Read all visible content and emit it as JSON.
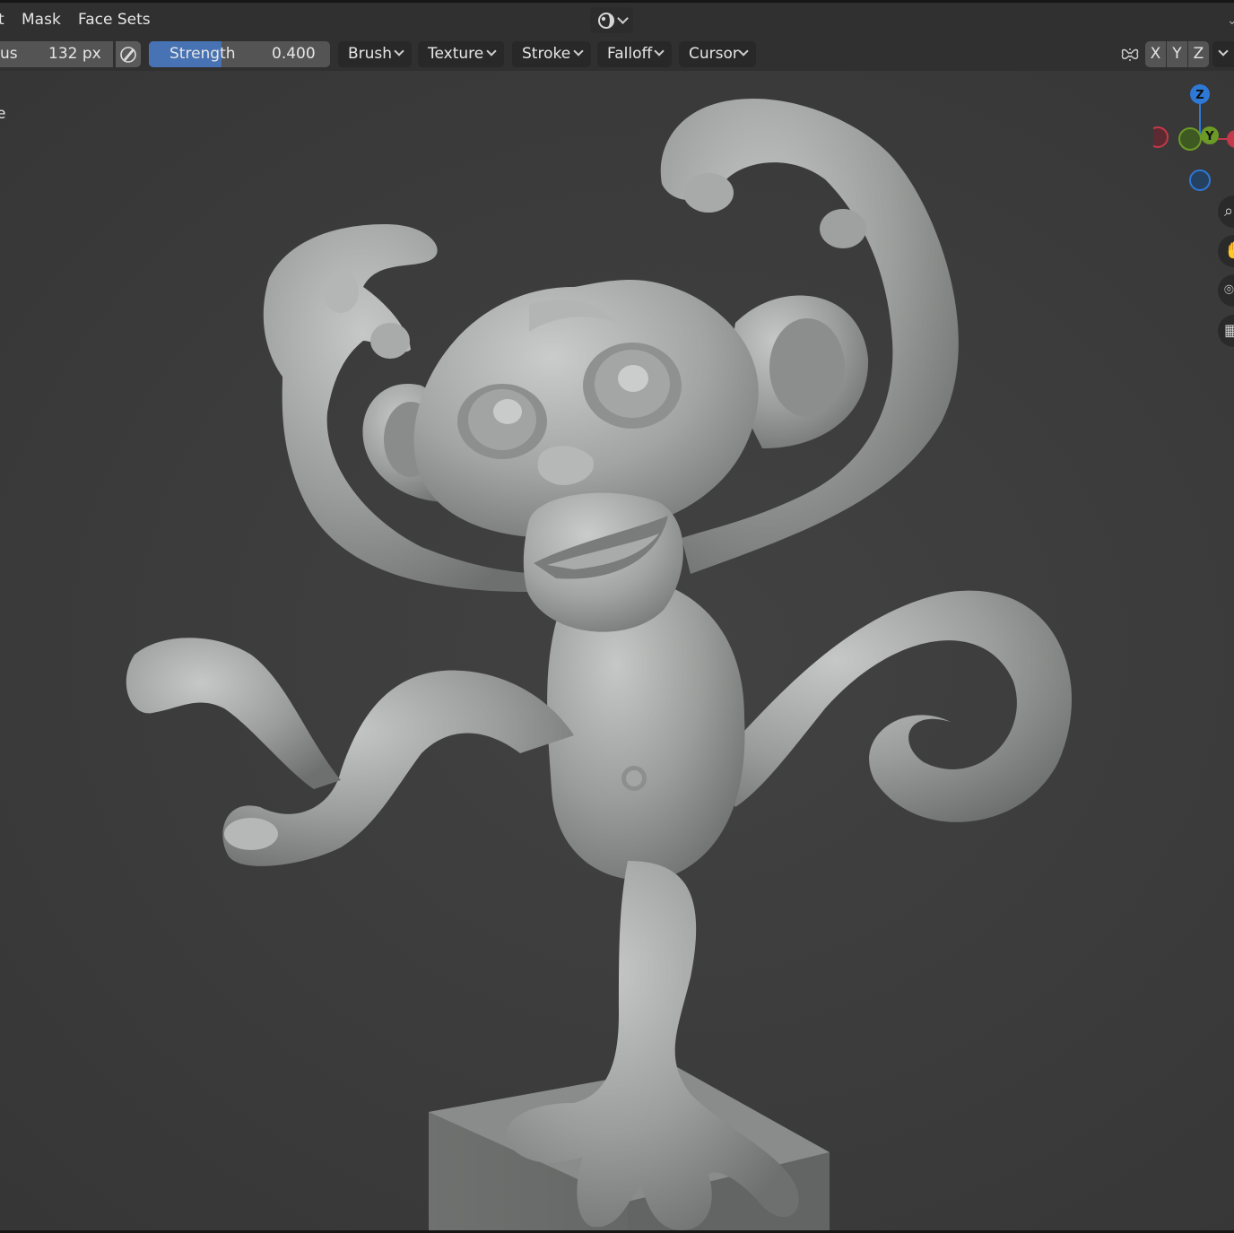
{
  "header": {
    "menu": [
      "t",
      "Mask",
      "Face Sets"
    ],
    "shading_icon": "viewport-shading-icon"
  },
  "toolbar": {
    "radius_label": "us",
    "radius_value": "132 px",
    "strength_label": "Strength",
    "strength_value": "0.400",
    "strength_fraction": 0.4,
    "dropdowns": [
      "Brush",
      "Texture",
      "Stroke",
      "Falloff",
      "Cursor"
    ],
    "symmetry_axes": [
      "X",
      "Y",
      "Z"
    ]
  },
  "viewport": {
    "overlay_text": "e",
    "gizmo": {
      "z_label": "Z",
      "y_label": "Y",
      "colors": {
        "x": "#c43949",
        "y": "#6c9a26",
        "z": "#2e78d6"
      }
    },
    "nav_icons": [
      "zoom-icon",
      "pan-hand-icon",
      "camera-icon",
      "grid-icon"
    ]
  },
  "colors": {
    "header_bg": "#303030",
    "field_bg": "#545454",
    "accent": "#4772b3",
    "viewport_bg": "#3d3d3d"
  }
}
